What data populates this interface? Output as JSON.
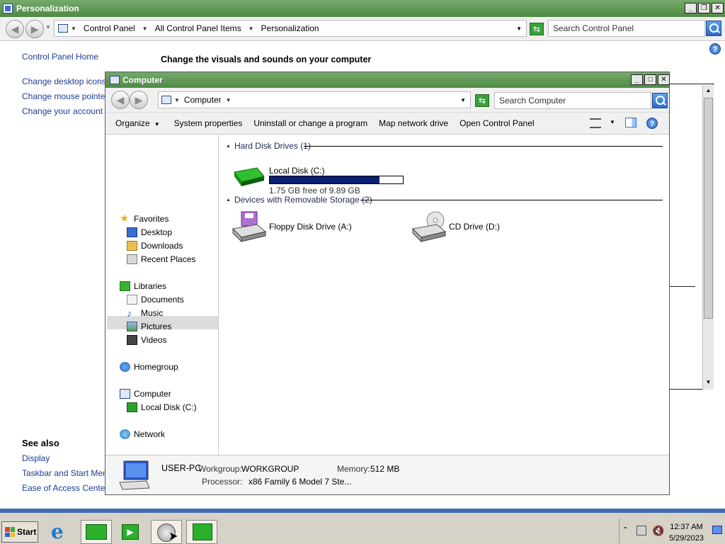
{
  "outer_window": {
    "title": "Personalization",
    "breadcrumbs": [
      "Control Panel",
      "All Control Panel Items",
      "Personalization"
    ],
    "search_placeholder": "Search Control Panel",
    "heading": "Change the visuals and sounds on your computer",
    "left_links": {
      "home": "Control Panel Home",
      "desktop_icons": "Change desktop icons",
      "mouse_pointers": "Change mouse pointers",
      "account_picture": "Change your account pi"
    },
    "see_also": {
      "title": "See also",
      "links": [
        "Display",
        "Taskbar and Start Menu",
        "Ease of Access Center"
      ]
    },
    "help_glyph": "?"
  },
  "computer_window": {
    "title": "Computer",
    "address": "Computer",
    "search_placeholder": "Search Computer",
    "toolbar": {
      "organize": "Organize",
      "system_properties": "System properties",
      "uninstall": "Uninstall or change a program",
      "map_drive": "Map network drive",
      "open_control_panel": "Open Control Panel"
    },
    "nav": {
      "favorites": "Favorites",
      "desktop": "Desktop",
      "downloads": "Downloads",
      "recent_places": "Recent Places",
      "libraries": "Libraries",
      "documents": "Documents",
      "music": "Music",
      "pictures": "Pictures",
      "videos": "Videos",
      "homegroup": "Homegroup",
      "computer": "Computer",
      "local_disk": "Local Disk (C:)",
      "network": "Network"
    },
    "groups": {
      "hdd": "Hard Disk Drives (1)",
      "removable": "Devices with Removable Storage (2)"
    },
    "drives": {
      "local_disk": {
        "name": "Local Disk (C:)",
        "free_text": "1.75 GB free of 9.89 GB",
        "used_fraction": 0.823
      },
      "floppy": "Floppy Disk Drive (A:)",
      "cd": "CD Drive (D:)"
    },
    "details": {
      "computer_name": "USER-PC",
      "workgroup_label": "Workgroup:",
      "workgroup": "WORKGROUP",
      "memory_label": "Memory:",
      "memory": "512 MB",
      "processor_label": "Processor:",
      "processor": "x86 Family 6 Model 7 Ste..."
    }
  },
  "taskbar": {
    "start_label": "Start",
    "time": "12:37 AM",
    "date": "5/29/2023"
  },
  "colors": {
    "titlebar_green": "#5a9650",
    "link_blue": "#1a3c9a",
    "progress_fill": "#0a1e72",
    "taskbar_blue": "#3e6bb0"
  }
}
